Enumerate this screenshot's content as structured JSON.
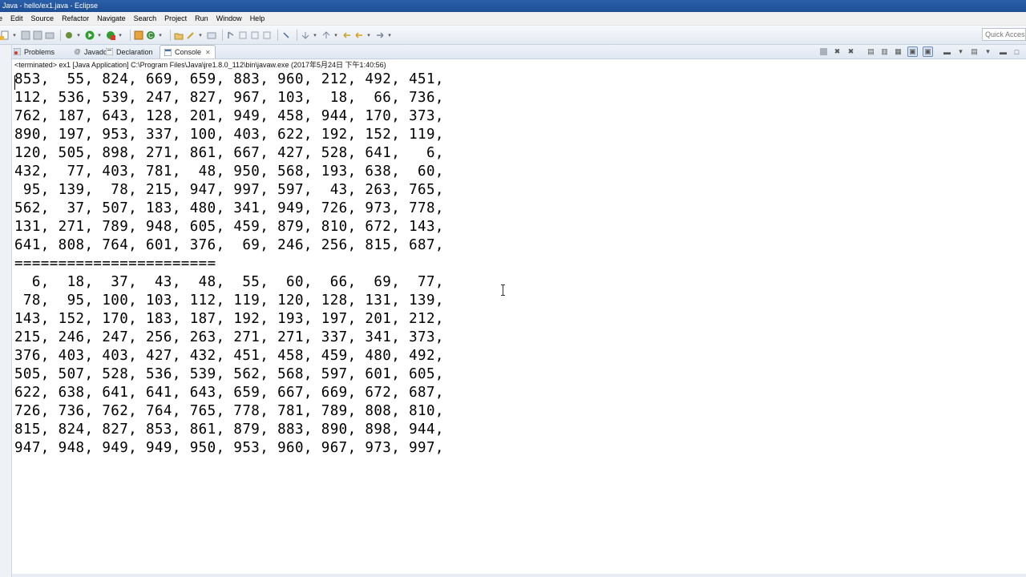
{
  "window": {
    "title": "Java - hello/ex1.java - Eclipse"
  },
  "menubar": {
    "items": [
      "e",
      "Edit",
      "Source",
      "Refactor",
      "Navigate",
      "Search",
      "Project",
      "Run",
      "Window",
      "Help"
    ]
  },
  "toolbar": {
    "quick_access_placeholder": "Quick Access"
  },
  "view_tabs": [
    {
      "label": "Problems",
      "icon": "problems-icon"
    },
    {
      "label": "Javadoc",
      "icon": "javadoc-icon"
    },
    {
      "label": "Declaration",
      "icon": "declaration-icon"
    },
    {
      "label": "Console",
      "icon": "console-icon",
      "active": true
    }
  ],
  "console": {
    "description": "<terminated> ex1 [Java Application] C:\\Program Files\\Java\\jre1.8.0_112\\bin\\javaw.exe (2017年5月24日 下午1:40:56)",
    "lines": [
      "853,  55, 824, 669, 659, 883, 960, 212, 492, 451,",
      "112, 536, 539, 247, 827, 967, 103,  18,  66, 736,",
      "762, 187, 643, 128, 201, 949, 458, 944, 170, 373,",
      "890, 197, 953, 337, 100, 403, 622, 192, 152, 119,",
      "120, 505, 898, 271, 861, 667, 427, 528, 641,   6,",
      "432,  77, 403, 781,  48, 950, 568, 193, 638,  60,",
      " 95, 139,  78, 215, 947, 997, 597,  43, 263, 765,",
      "562,  37, 507, 183, 480, 341, 949, 726, 973, 778,",
      "131, 271, 789, 948, 605, 459, 879, 810, 672, 143,",
      "641, 808, 764, 601, 376,  69, 246, 256, 815, 687,",
      "=======================",
      "  6,  18,  37,  43,  48,  55,  60,  66,  69,  77,",
      " 78,  95, 100, 103, 112, 119, 120, 128, 131, 139,",
      "143, 152, 170, 183, 187, 192, 193, 197, 201, 212,",
      "215, 246, 247, 256, 263, 271, 271, 337, 341, 373,",
      "376, 403, 403, 427, 432, 451, 458, 459, 480, 492,",
      "505, 507, 528, 536, 539, 562, 568, 597, 601, 605,",
      "622, 638, 641, 641, 643, 659, 667, 669, 672, 687,",
      "726, 736, 762, 764, 765, 778, 781, 789, 808, 810,",
      "815, 824, 827, 853, 861, 879, 883, 890, 898, 944,",
      "947, 948, 949, 949, 950, 953, 960, 967, 973, 997,"
    ]
  },
  "colors": {
    "titlebar": "#2a5fa8",
    "run_green": "#2e9e2e",
    "terminate_red": "#d33b2c"
  }
}
